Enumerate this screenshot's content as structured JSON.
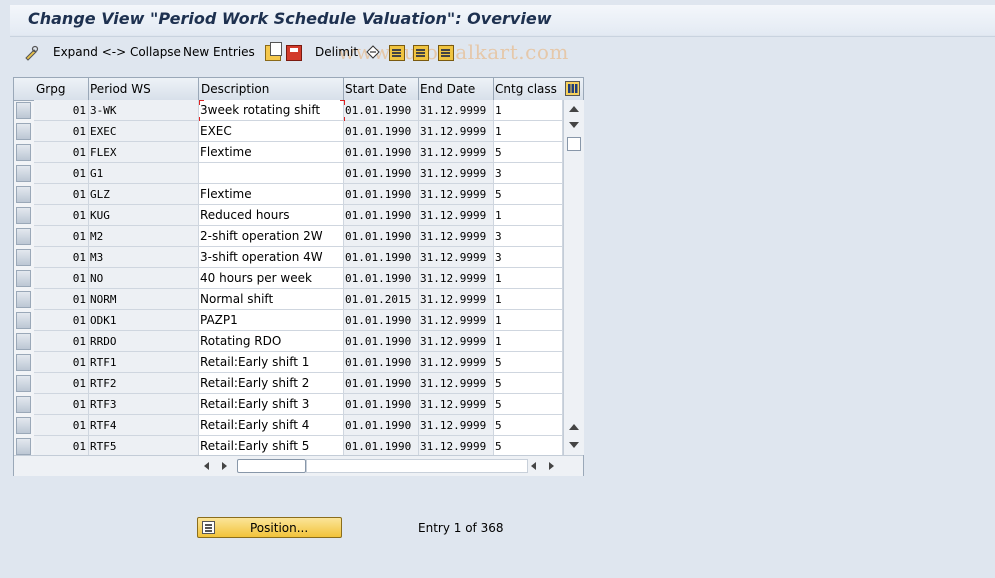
{
  "window": {
    "title": "Change View \"Period Work Schedule Valuation\": Overview"
  },
  "toolbar": {
    "expand_collapse_label": "Expand <-> Collapse",
    "new_entries_label": "New Entries",
    "delimit_label": "Delimit",
    "watermark": "www.tutorialkart.com"
  },
  "table": {
    "headers": {
      "grpg": "Grpg",
      "period_ws": "Period WS",
      "description": "Description",
      "start_date": "Start Date",
      "end_date": "End Date",
      "cntg_class": "Cntg class"
    },
    "rows": [
      {
        "grpg": "01",
        "period_ws": "3-WK",
        "description": "3week rotating shift",
        "start": "01.01.1990",
        "end": "31.12.9999",
        "cntg": "1"
      },
      {
        "grpg": "01",
        "period_ws": "EXEC",
        "description": "EXEC",
        "start": "01.01.1990",
        "end": "31.12.9999",
        "cntg": "1"
      },
      {
        "grpg": "01",
        "period_ws": "FLEX",
        "description": "Flextime",
        "start": "01.01.1990",
        "end": "31.12.9999",
        "cntg": "5"
      },
      {
        "grpg": "01",
        "period_ws": "G1",
        "description": "",
        "start": "01.01.1990",
        "end": "31.12.9999",
        "cntg": "3"
      },
      {
        "grpg": "01",
        "period_ws": "GLZ",
        "description": "Flextime",
        "start": "01.01.1990",
        "end": "31.12.9999",
        "cntg": "5"
      },
      {
        "grpg": "01",
        "period_ws": "KUG",
        "description": "Reduced hours",
        "start": "01.01.1990",
        "end": "31.12.9999",
        "cntg": "1"
      },
      {
        "grpg": "01",
        "period_ws": "M2",
        "description": "2-shift operation 2W",
        "start": "01.01.1990",
        "end": "31.12.9999",
        "cntg": "3"
      },
      {
        "grpg": "01",
        "period_ws": "M3",
        "description": "3-shift operation 4W",
        "start": "01.01.1990",
        "end": "31.12.9999",
        "cntg": "3"
      },
      {
        "grpg": "01",
        "period_ws": "NO",
        "description": "40 hours per week",
        "start": "01.01.1990",
        "end": "31.12.9999",
        "cntg": "1"
      },
      {
        "grpg": "01",
        "period_ws": "NORM",
        "description": "Normal shift",
        "start": "01.01.2015",
        "end": "31.12.9999",
        "cntg": "1"
      },
      {
        "grpg": "01",
        "period_ws": "ODK1",
        "description": "PAZP1",
        "start": "01.01.1990",
        "end": "31.12.9999",
        "cntg": "1"
      },
      {
        "grpg": "01",
        "period_ws": "RRDO",
        "description": "Rotating RDO",
        "start": "01.01.1990",
        "end": "31.12.9999",
        "cntg": "1"
      },
      {
        "grpg": "01",
        "period_ws": "RTF1",
        "description": "Retail:Early shift 1",
        "start": "01.01.1990",
        "end": "31.12.9999",
        "cntg": "5"
      },
      {
        "grpg": "01",
        "period_ws": "RTF2",
        "description": "Retail:Early shift 2",
        "start": "01.01.1990",
        "end": "31.12.9999",
        "cntg": "5"
      },
      {
        "grpg": "01",
        "period_ws": "RTF3",
        "description": "Retail:Early shift 3",
        "start": "01.01.1990",
        "end": "31.12.9999",
        "cntg": "5"
      },
      {
        "grpg": "01",
        "period_ws": "RTF4",
        "description": "Retail:Early shift 4",
        "start": "01.01.1990",
        "end": "31.12.9999",
        "cntg": "5"
      },
      {
        "grpg": "01",
        "period_ws": "RTF5",
        "description": "Retail:Early shift 5",
        "start": "01.01.1990",
        "end": "31.12.9999",
        "cntg": "5"
      }
    ]
  },
  "footer": {
    "position_label": "Position...",
    "entry_info": "Entry 1 of 368"
  },
  "colors": {
    "accent": "#f2c33b",
    "title": "#1e3150",
    "background": "#dfe6ef"
  }
}
